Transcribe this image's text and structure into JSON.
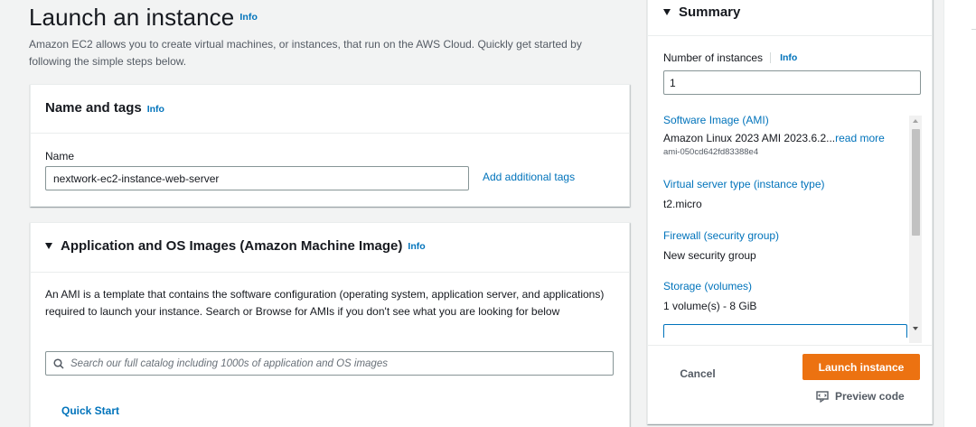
{
  "header": {
    "title": "Launch an instance",
    "info": "Info",
    "description": "Amazon EC2 allows you to create virtual machines, or instances, that run on the AWS Cloud. Quickly get started by following the simple steps below."
  },
  "name_tags": {
    "title": "Name and tags",
    "info": "Info",
    "name_label": "Name",
    "name_value": "nextwork-ec2-instance-web-server",
    "add_tags": "Add additional tags"
  },
  "ami": {
    "title": "Application and OS Images (Amazon Machine Image)",
    "info": "Info",
    "description": "An AMI is a template that contains the software configuration (operating system, application server, and applications) required to launch your instance. Search or Browse for AMIs if you don't see what you are looking for below",
    "search_placeholder": "Search our full catalog including 1000s of application and OS images",
    "quick_start": "Quick Start"
  },
  "summary": {
    "title": "Summary",
    "num_instances_label": "Number of instances",
    "info": "Info",
    "num_instances_value": "1",
    "items": [
      {
        "key": "Software Image (AMI)",
        "value": "Amazon Linux 2023 AMI 2023.6.2...",
        "link": "read more",
        "sub": "ami-050cd642fd83388e4"
      },
      {
        "key": "Virtual server type (instance type)",
        "value": "t2.micro"
      },
      {
        "key": "Firewall (security group)",
        "value": "New security group"
      },
      {
        "key": "Storage (volumes)",
        "value": "1 volume(s) - 8 GiB"
      }
    ],
    "cancel": "Cancel",
    "launch": "Launch instance",
    "preview": "Preview code"
  },
  "colors": {
    "accent": "#0073bb",
    "primary_button": "#ec7211",
    "background": "#f2f3f3"
  },
  "icons": {
    "search": "search-icon",
    "caret": "caret-down-icon",
    "preview": "code-preview-icon"
  }
}
